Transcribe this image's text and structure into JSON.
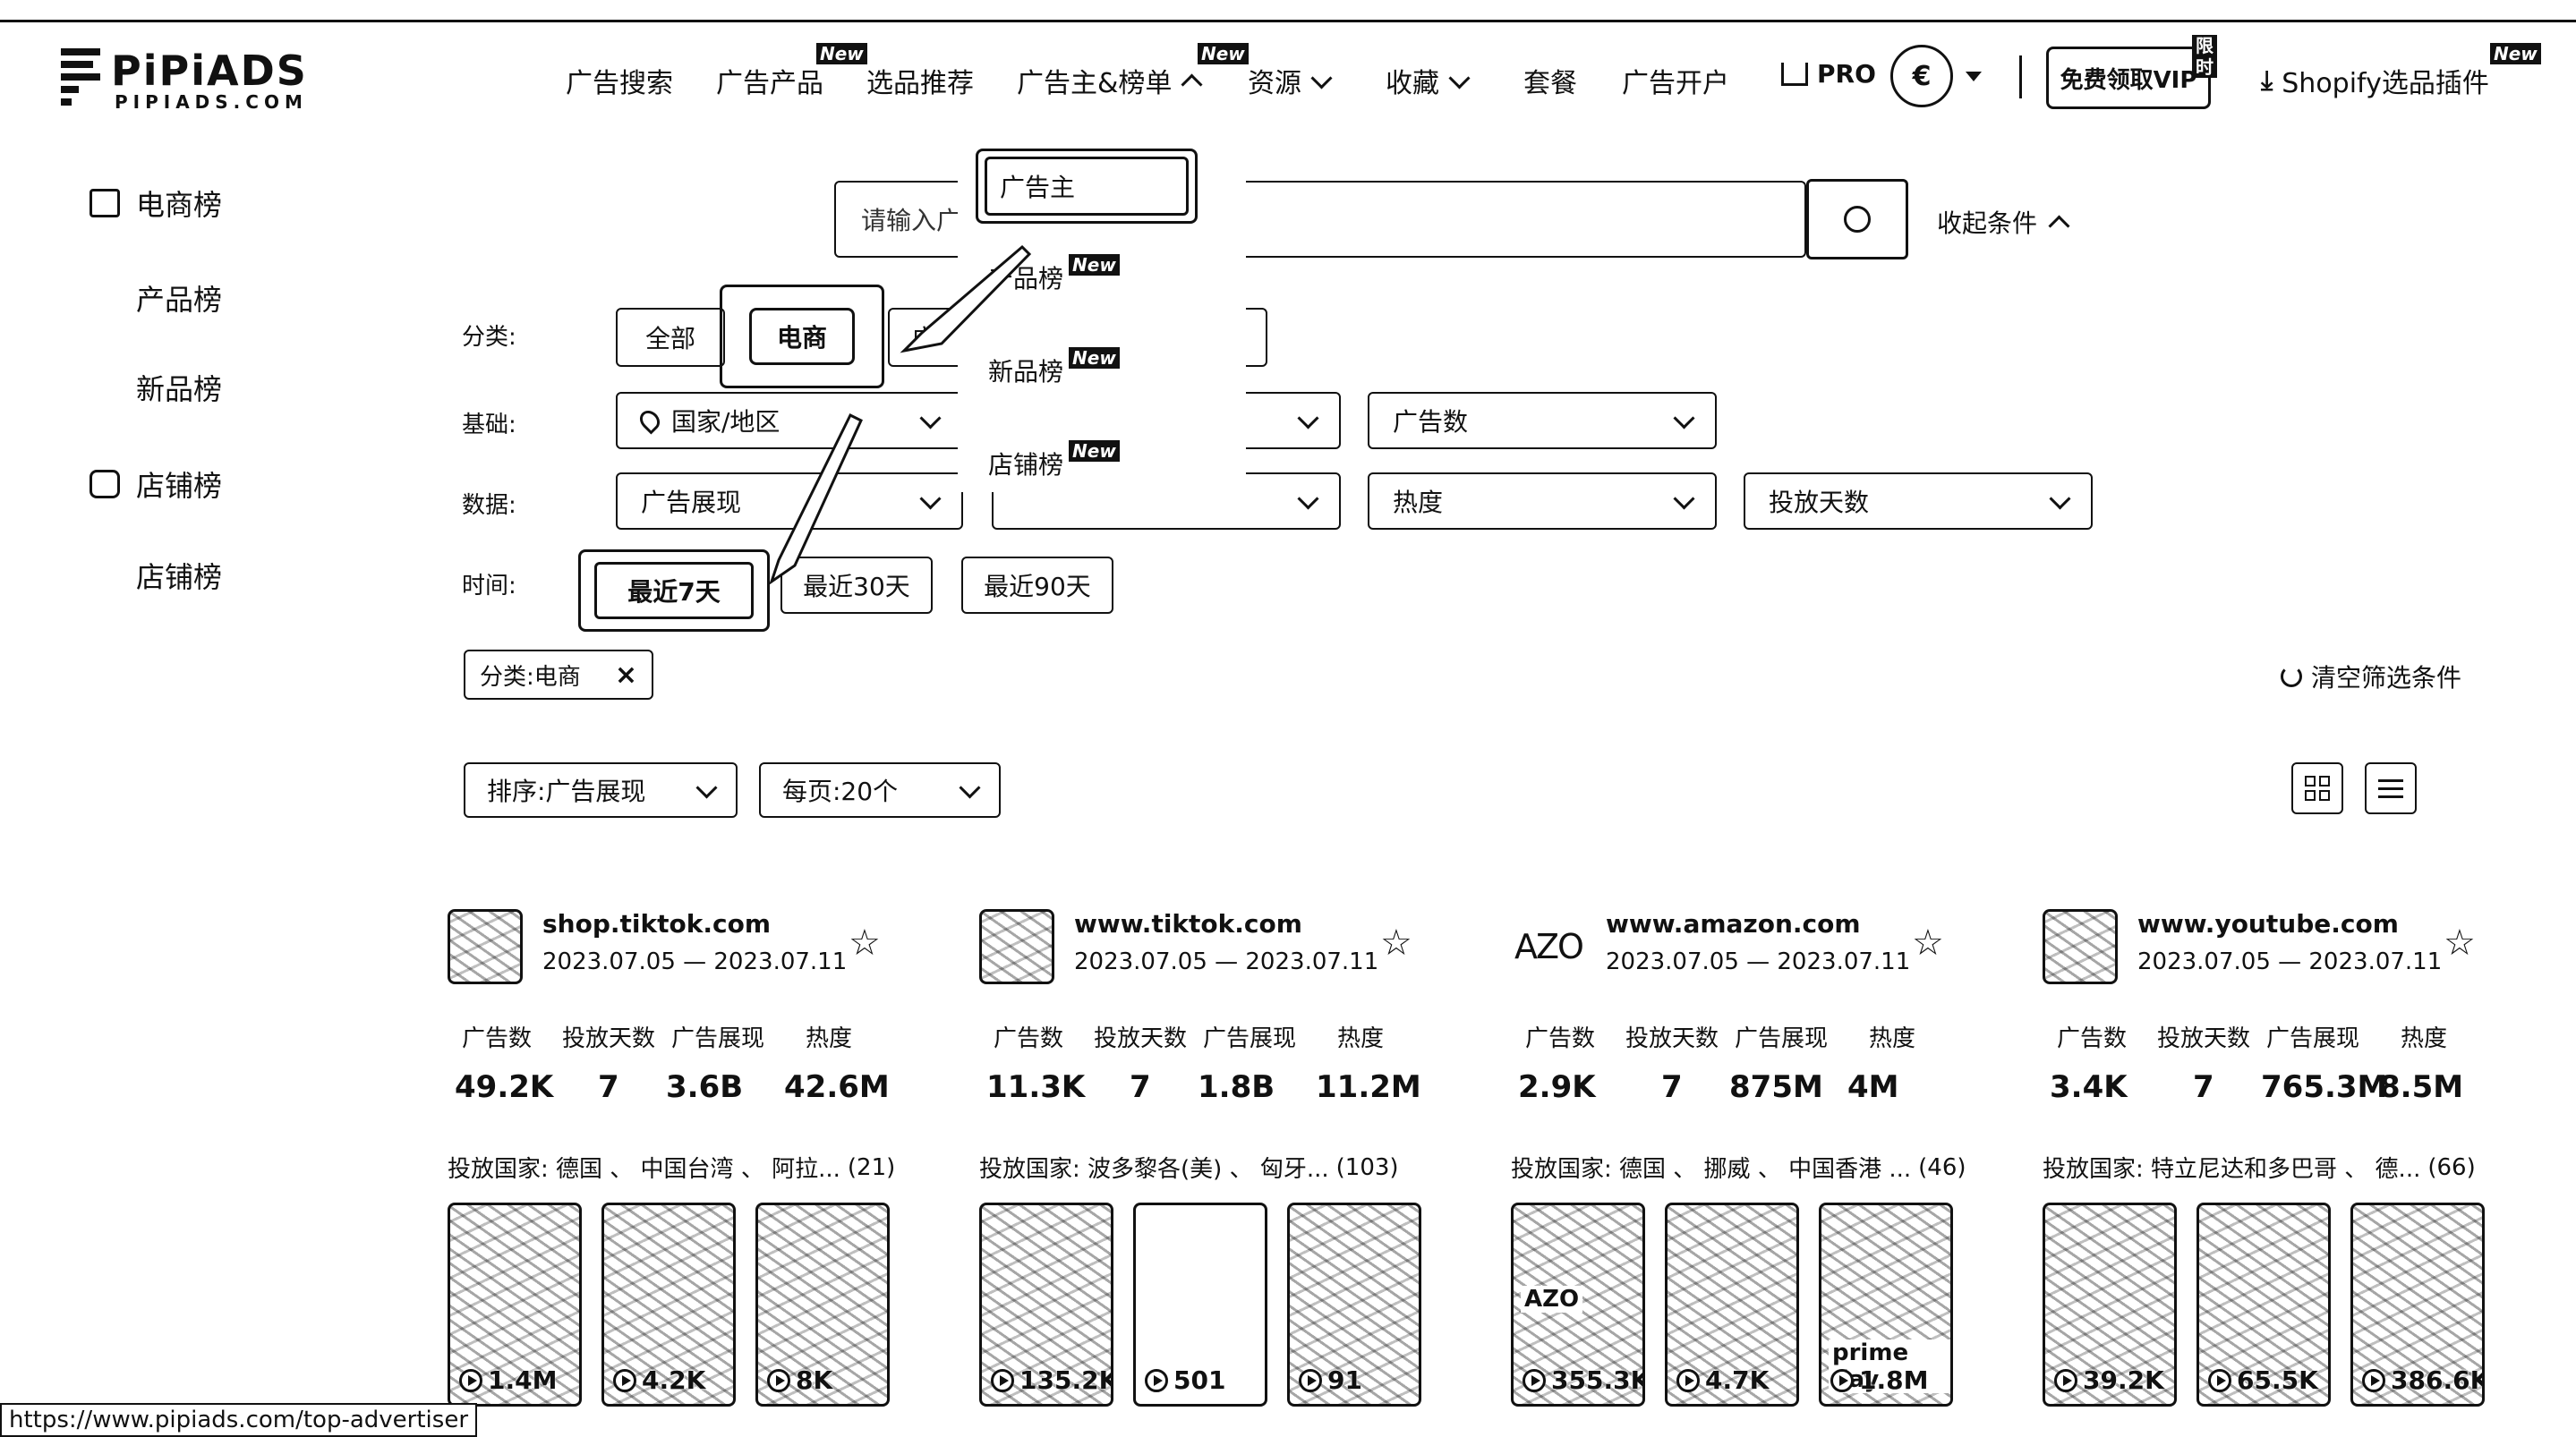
{
  "topbar_strip": "",
  "logo": {
    "brand": "PiPiADS",
    "sub": "PIPIADS.COM"
  },
  "nav": {
    "items": [
      {
        "label": "广告搜索"
      },
      {
        "label": "广告产品",
        "badge": "New"
      },
      {
        "label": "选品推荐"
      },
      {
        "label": "广告主&榜单",
        "badge": "New"
      },
      {
        "label": "资源"
      },
      {
        "label": "收藏"
      },
      {
        "label": "套餐"
      },
      {
        "label": "广告开户"
      }
    ],
    "pro": "PRO",
    "currency_symbol": "€",
    "vip_button": "免费领取VIP",
    "vip_badge": "限时",
    "shopify": "Shopify选品插件",
    "shopify_badge": "New"
  },
  "dropdown": {
    "items": [
      {
        "label": "广告主"
      },
      {
        "label": "产品榜",
        "badge": "New"
      },
      {
        "label": "新品榜",
        "badge": "New"
      },
      {
        "label": "店铺榜",
        "badge": "New"
      }
    ]
  },
  "sidebar": {
    "groups": [
      {
        "title": "电商榜",
        "icon": "shopping-bag-icon",
        "items": [
          "产品榜",
          "新品榜"
        ]
      },
      {
        "title": "店铺榜",
        "icon": "store-icon",
        "items": [
          "店铺榜"
        ]
      }
    ]
  },
  "search": {
    "placeholder": "请输入广",
    "collapse": "收起条件"
  },
  "filters": {
    "category_label": "分类:",
    "category_all": "全部",
    "category_ecom": "电商",
    "category_third": "广",
    "basic_label": "基础:",
    "country": "国家/地区",
    "ad_count": "广告数",
    "data_label": "数据:",
    "impressions": "广告展现",
    "heat": "热度",
    "days": "投放天数",
    "time_label": "时间:",
    "time_options": [
      "最近7天",
      "最近30天",
      "最近90天"
    ]
  },
  "active_filter": {
    "text": "分类:电商"
  },
  "clear_filters": "清空筛选条件",
  "sort": {
    "label": "排序:广告展现",
    "per_page": "每页:20个"
  },
  "cards": [
    {
      "domain": "shop.tiktok.com",
      "dates": "2023.07.05 — 2023.07.11",
      "stats_labels": [
        "广告数",
        "投放天数",
        "广告展现",
        "热度"
      ],
      "stats_values": [
        "49.2K",
        "7",
        "3.6B",
        "42.6M"
      ],
      "countries": "投放国家: 德国 、 中国台湾 、 阿拉...",
      "country_count": "(21)",
      "thumbs": [
        "1.4M",
        "4.2K",
        "8K"
      ]
    },
    {
      "domain": "www.tiktok.com",
      "dates": "2023.07.05 — 2023.07.11",
      "stats_labels": [
        "广告数",
        "投放天数",
        "广告展现",
        "热度"
      ],
      "stats_values": [
        "11.3K",
        "7",
        "1.8B",
        "11.2M"
      ],
      "countries": "投放国家: 波多黎各(美) 、 匈牙...",
      "country_count": "(103)",
      "thumbs": [
        "135.2K",
        "501",
        "91"
      ]
    },
    {
      "domain": "www.amazon.com",
      "logo_text": "AZO",
      "dates": "2023.07.05 — 2023.07.11",
      "stats_labels": [
        "广告数",
        "投放天数",
        "广告展现",
        "热度"
      ],
      "stats_values": [
        "2.9K",
        "7",
        "875M",
        "4M"
      ],
      "countries": "投放国家: 德国 、 挪威 、 中国香港 ...",
      "country_count": "(46)",
      "thumbs": [
        "355.3K",
        "4.7K",
        "1.8M"
      ],
      "thumb_texts": [
        "AZO",
        "",
        "prime day"
      ]
    },
    {
      "domain": "www.youtube.com",
      "dates": "2023.07.05 — 2023.07.11",
      "stats_labels": [
        "广告数",
        "投放天数",
        "广告展现",
        "热度"
      ],
      "stats_values": [
        "3.4K",
        "7",
        "765.3M",
        "8.5M"
      ],
      "countries": "投放国家: 特立尼达和多巴哥 、 德...",
      "country_count": "(66)",
      "thumbs": [
        "39.2K",
        "65.5K",
        "386.6K"
      ]
    }
  ],
  "status_url": "https://www.pipiads.com/top-advertiser"
}
